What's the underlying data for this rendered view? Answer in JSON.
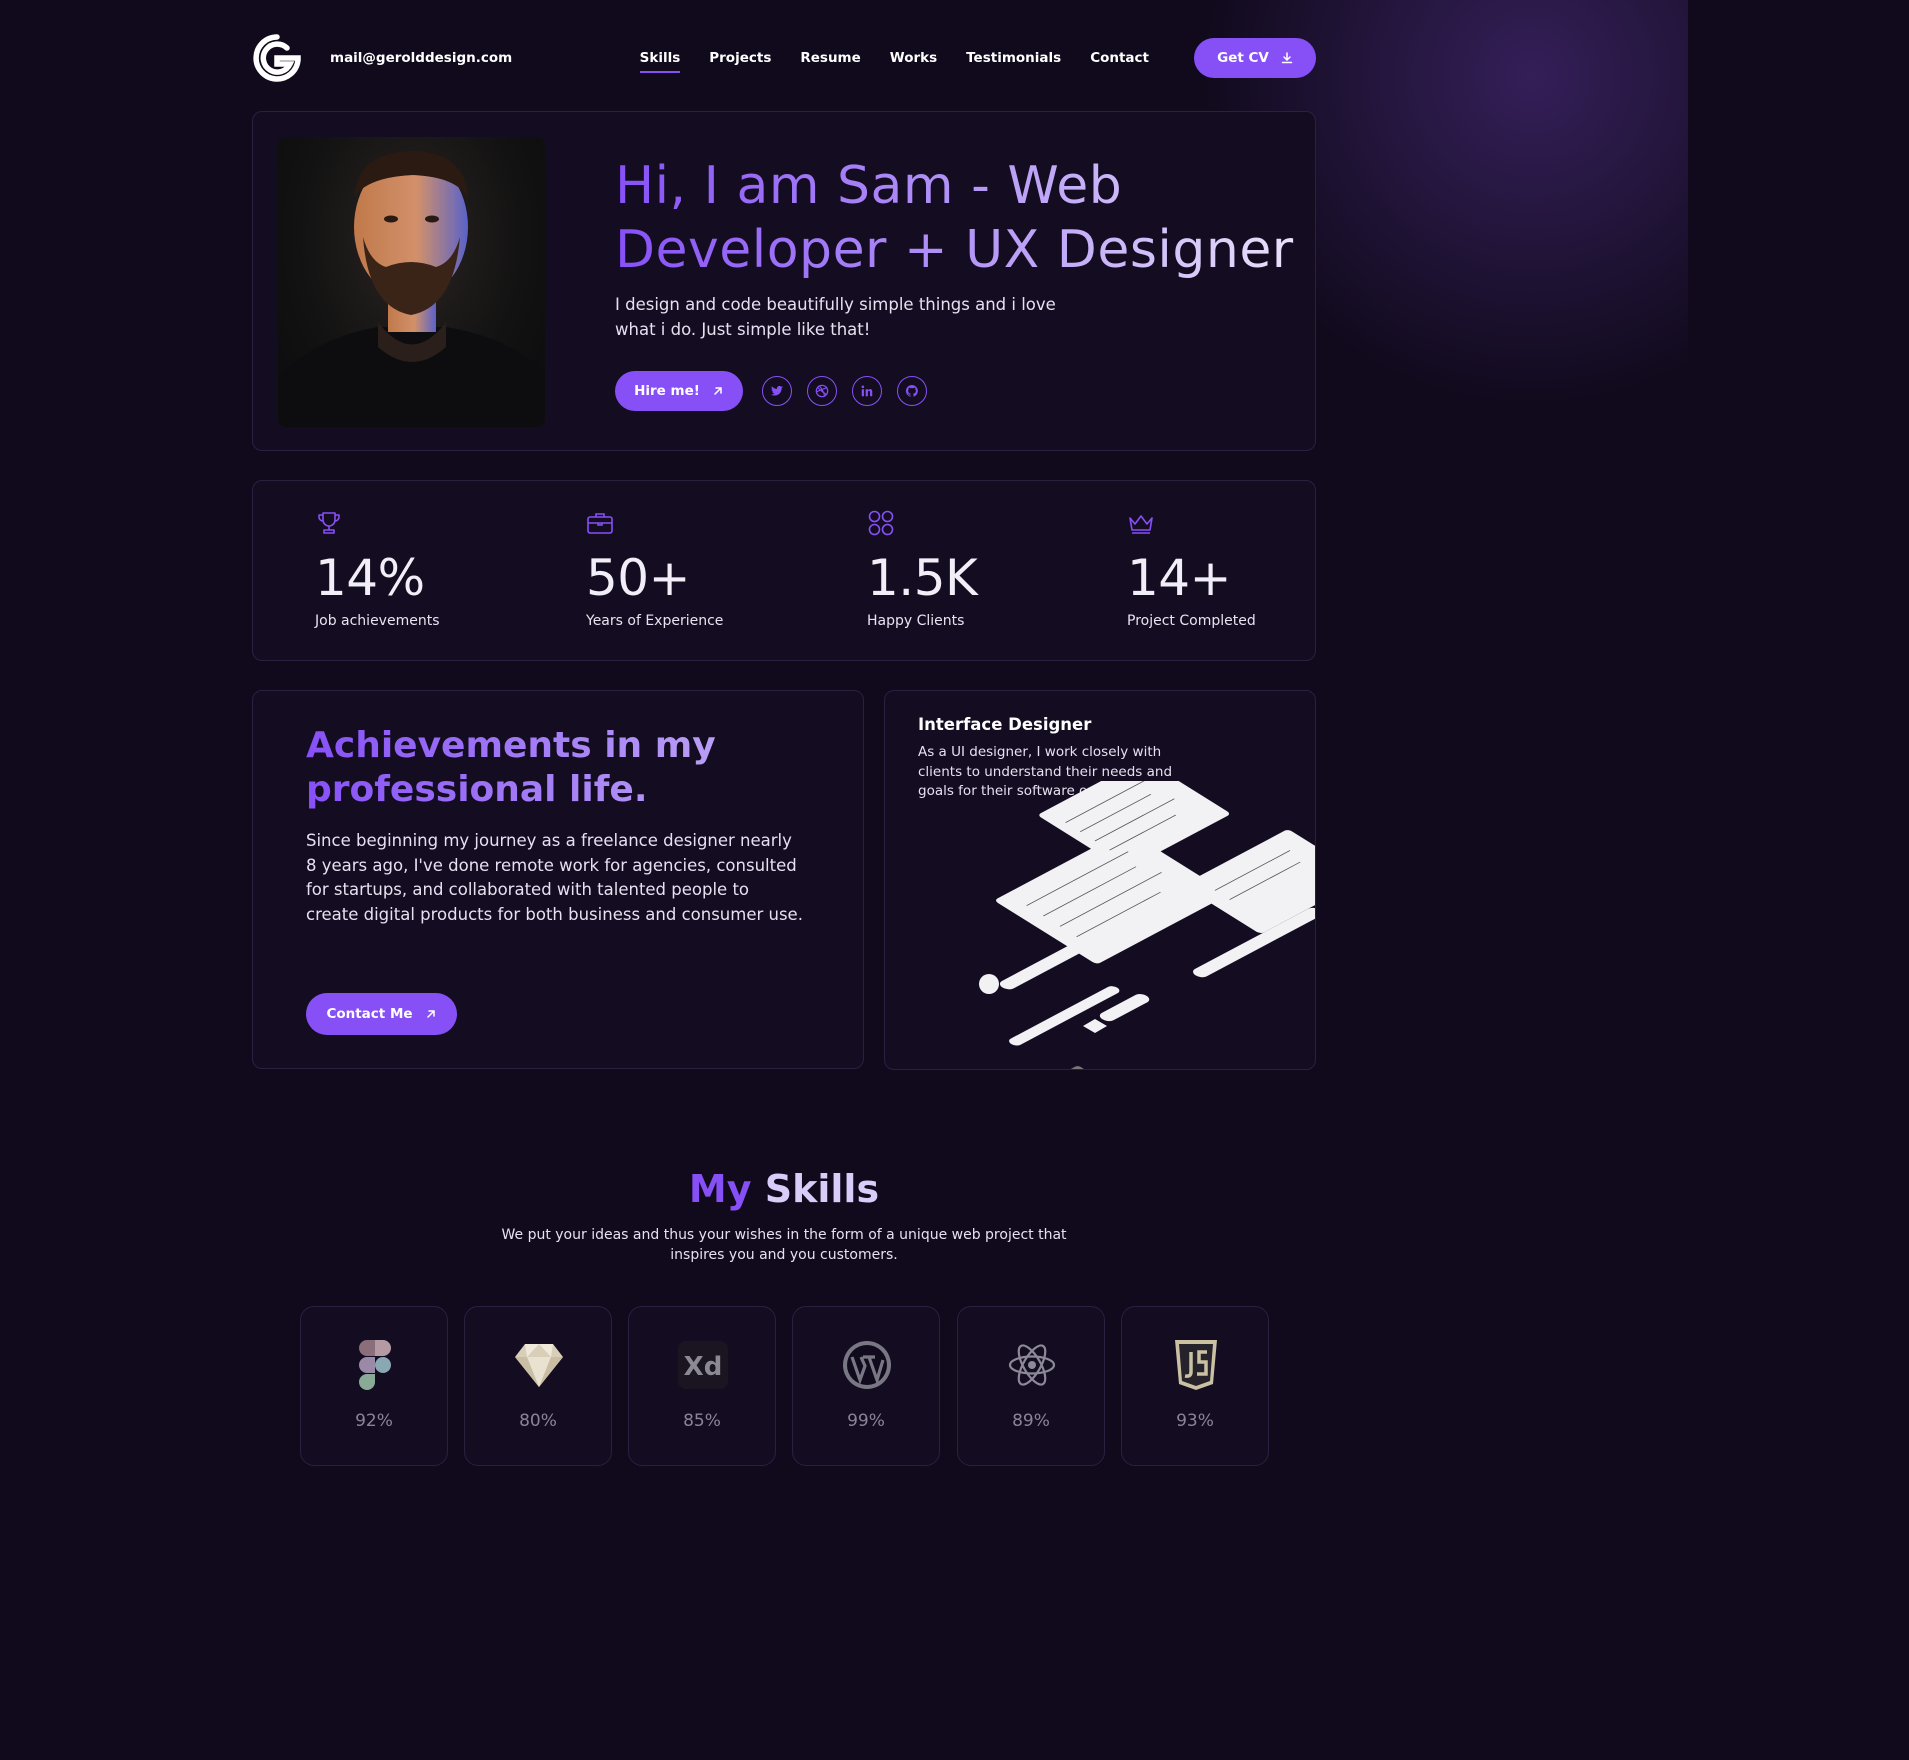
{
  "header": {
    "email": "mail@gerolddesign.com",
    "nav": [
      "Skills",
      "Projects",
      "Resume",
      "Works",
      "Testimonials",
      "Contact"
    ],
    "active_nav": "Skills",
    "cta_label": "Get CV"
  },
  "hero": {
    "title": "Hi, I am Sam - Web Developer + UX Designer",
    "description": "I design and code beautifully simple things and i love what i do. Just simple like that!",
    "hire_label": "Hire me!",
    "socials": [
      "twitter-icon",
      "dribbble-icon",
      "linkedin-icon",
      "github-icon"
    ]
  },
  "stats": [
    {
      "icon": "trophy-icon",
      "value": "14%",
      "label": "Job achievements"
    },
    {
      "icon": "briefcase-icon",
      "value": "50+",
      "label": "Years of Experience"
    },
    {
      "icon": "grid-circles-icon",
      "value": "1.5K",
      "label": "Happy Clients"
    },
    {
      "icon": "crown-icon",
      "value": "14+",
      "label": "Project Completed"
    }
  ],
  "achievements": {
    "title": "Achievements in my professional life.",
    "description": "Since beginning my journey as a freelance designer nearly 8 years ago, I've done remote work for agencies, consulted for startups, and collaborated with talented people to create digital products for both business and consumer use.",
    "contact_label": "Contact Me"
  },
  "interface": {
    "title": "Interface Designer",
    "description": "As a UI designer, I work closely with clients to understand their needs and goals for their software or website."
  },
  "skills": {
    "title_a": "My",
    "title_b": "Skills",
    "description": "We put your ideas and thus your wishes in the form of a unique web project that inspires you and you customers.",
    "items": [
      {
        "icon": "figma-icon",
        "percent": "92%"
      },
      {
        "icon": "sketch-icon",
        "percent": "80%"
      },
      {
        "icon": "adobe-xd-icon",
        "percent": "85%"
      },
      {
        "icon": "wordpress-icon",
        "percent": "99%"
      },
      {
        "icon": "react-icon",
        "percent": "89%"
      },
      {
        "icon": "javascript-icon",
        "percent": "93%"
      }
    ]
  },
  "colors": {
    "accent": "#8750f7",
    "background": "#100a1c",
    "card": "#140d22",
    "border": "#2a2040"
  }
}
